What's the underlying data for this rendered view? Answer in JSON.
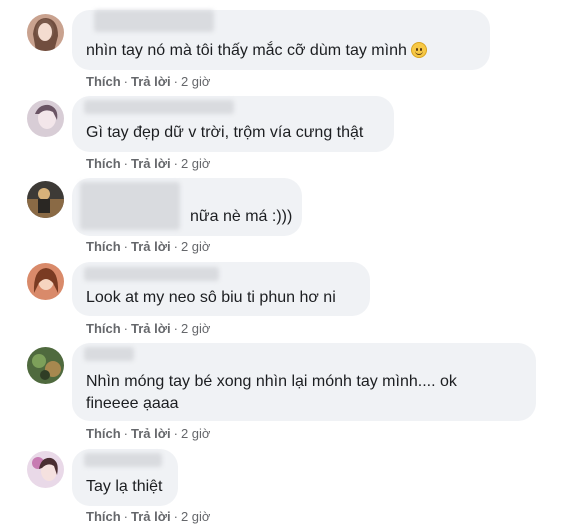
{
  "actions": {
    "like": "Thích",
    "reply": "Trả lời",
    "separator": "·"
  },
  "comments": [
    {
      "text": "nhìn tay nó mà tôi thấy mắc cỡ dùm tay mình",
      "time": "2 giờ",
      "emoji": "smiling-face-icon",
      "avatar": "user-avatar-1"
    },
    {
      "text": "Gì tay đẹp dữ v trời, trộm vía cưng thật",
      "time": "2 giờ",
      "avatar": "user-avatar-2"
    },
    {
      "text": "nữa nè má :)))",
      "time": "2 giờ",
      "avatar": "user-avatar-3"
    },
    {
      "text": "Look at my neo sô biu ti phun hơ ni",
      "time": "2 giờ",
      "avatar": "user-avatar-4"
    },
    {
      "text_line1": "Nhìn móng tay bé xong nhìn lại mónh tay mình.... ok",
      "text_line2": "fineeee ạaaa",
      "time": "2 giờ",
      "avatar": "user-avatar-5"
    },
    {
      "text": "Tay lạ thiệt",
      "time": "2 giờ",
      "avatar": "user-avatar-6"
    }
  ],
  "colors": {
    "bubble": "#f0f2f5",
    "text": "#1c1e21",
    "meta": "#65676b"
  }
}
